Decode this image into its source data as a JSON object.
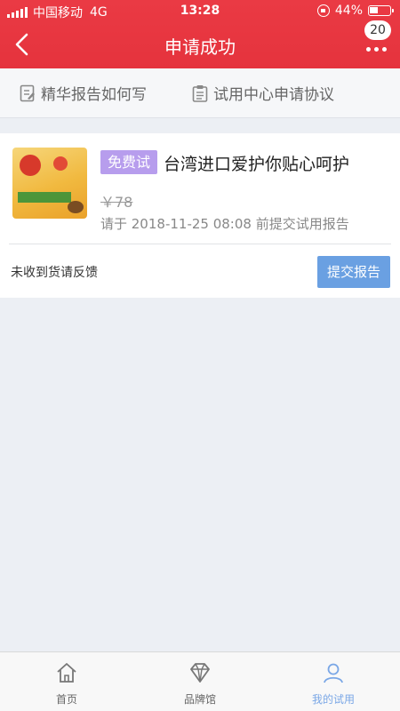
{
  "status_bar": {
    "carrier": "中国移动",
    "network": "4G",
    "time": "13:28",
    "battery": "44%",
    "battery_level": 0.44
  },
  "nav": {
    "title": "申请成功",
    "badge_count": "20"
  },
  "quick_links": [
    {
      "label": "精华报告如何写",
      "icon": "document-edit-icon"
    },
    {
      "label": "试用中心申请协议",
      "icon": "clipboard-icon"
    }
  ],
  "trial": {
    "tag": "免费试",
    "title": "台湾进口爱护你贴心呵护",
    "price": "￥78",
    "deadline": "请于 2018-11-25 08:08 前提交试用报告",
    "feedback_link": "未收到货请反馈",
    "submit_label": "提交报告"
  },
  "tabbar": [
    {
      "label": "首页",
      "icon": "home-icon",
      "active": false
    },
    {
      "label": "品牌馆",
      "icon": "diamond-icon",
      "active": false
    },
    {
      "label": "我的试用",
      "icon": "user-icon",
      "active": true
    }
  ],
  "colors": {
    "header": "#e5333d",
    "tag": "#b79ded",
    "button": "#6aa0e2",
    "active_tab": "#7aa7e6"
  }
}
